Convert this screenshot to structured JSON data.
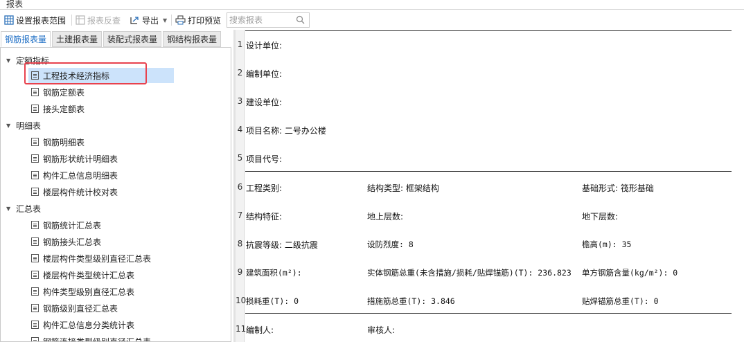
{
  "window": {
    "title": "报表"
  },
  "toolbar": {
    "set_range": "设置报表范围",
    "reverse_check": "报表反查",
    "export": "导出",
    "print_preview": "打印预览",
    "search_placeholder": "搜索报表"
  },
  "tabs": [
    {
      "label": "钢筋报表量",
      "active": true
    },
    {
      "label": "土建报表量",
      "active": false
    },
    {
      "label": "装配式报表量",
      "active": false
    },
    {
      "label": "钢结构报表量",
      "active": false
    }
  ],
  "tree": {
    "groups": [
      {
        "label": "定额指标",
        "items": [
          "工程技术经济指标",
          "钢筋定额表",
          "接头定额表"
        ]
      },
      {
        "label": "明细表",
        "items": [
          "钢筋明细表",
          "钢筋形状统计明细表",
          "构件汇总信息明细表",
          "楼层构件统计校对表"
        ]
      },
      {
        "label": "汇总表",
        "items": [
          "钢筋统计汇总表",
          "钢筋接头汇总表",
          "楼层构件类型级别直径汇总表",
          "楼层构件类型统计汇总表",
          "构件类型级别直径汇总表",
          "钢筋级别直径汇总表",
          "构件汇总信息分类统计表",
          "钢筋连接类型级别直径汇总表"
        ]
      }
    ],
    "selected": "工程技术经济指标"
  },
  "report": {
    "row_numbers": [
      "1",
      "2",
      "3",
      "4",
      "5",
      "6",
      "7",
      "8",
      "9",
      "10",
      "11"
    ],
    "r1": "设计单位:",
    "r2": "编制单位:",
    "r3": "建设单位:",
    "r4": "项目名称: 二号办公楼",
    "r5": "项目代号:",
    "r6": [
      "工程类别:",
      "结构类型: 框架结构",
      "基础形式: 筏形基础"
    ],
    "r7": [
      "结构特征:",
      "地上层数:",
      "地下层数:"
    ],
    "r8": [
      "抗震等级: 二级抗震",
      "设防烈度: 8",
      "檐高(m): 35"
    ],
    "r9": [
      "建筑面积(m²):",
      "实体钢筋总重(未含措施/损耗/贴焊锚筋)(T): 236.823",
      "单方钢筋含量(kg/m²): 0"
    ],
    "r10": [
      "损耗重(T): 0",
      "措施筋总重(T): 3.846",
      "贴焊锚筋总重(T): 0"
    ],
    "r11": [
      "编制人:",
      "审核人:"
    ]
  },
  "colors": {
    "accent": "#1f6fc5",
    "selection": "#cce3fb",
    "highlight_box": "#e8424e"
  }
}
